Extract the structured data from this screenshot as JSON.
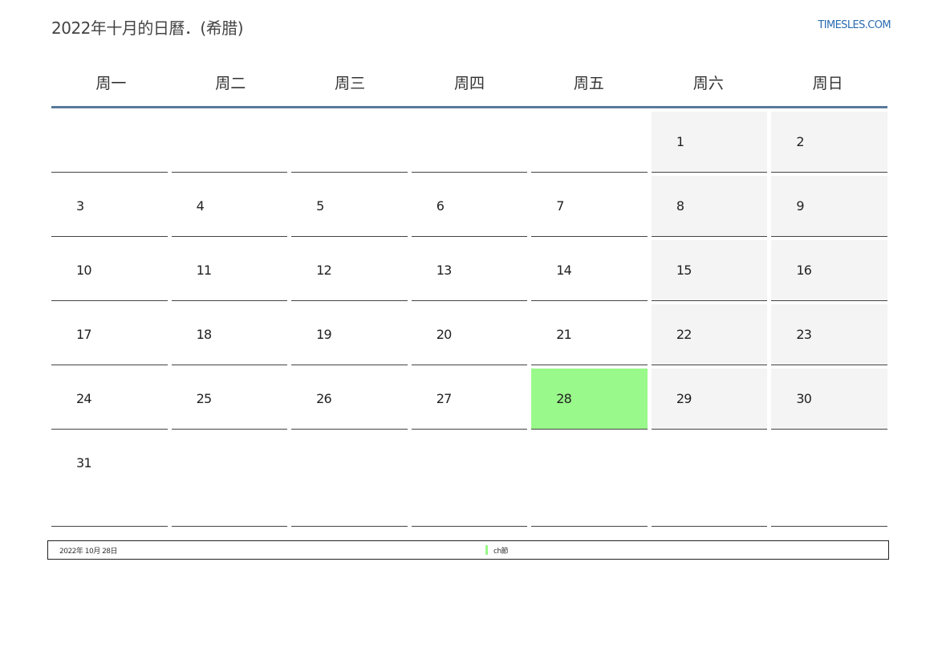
{
  "header": {
    "title": "2022年十月的日曆．(希腊)",
    "site": "TIMESLES.COM"
  },
  "weekdays": [
    "周一",
    "周二",
    "周三",
    "周四",
    "周五",
    "周六",
    "周日"
  ],
  "weeks": [
    [
      "",
      "",
      "",
      "",
      "",
      "1",
      "2"
    ],
    [
      "3",
      "4",
      "5",
      "6",
      "7",
      "8",
      "9"
    ],
    [
      "10",
      "11",
      "12",
      "13",
      "14",
      "15",
      "16"
    ],
    [
      "17",
      "18",
      "19",
      "20",
      "21",
      "22",
      "23"
    ],
    [
      "24",
      "25",
      "26",
      "27",
      "28",
      "29",
      "30"
    ],
    [
      "31",
      "",
      "",
      "",
      "",
      "",
      ""
    ]
  ],
  "today": "28",
  "colors": {
    "today": "#99f98a",
    "weekend": "#f4f4f4",
    "header_rule": "#5a7a9c",
    "link": "#2b6cb0"
  },
  "footer": {
    "date": "2022年 10月 28日",
    "legend_label": "ch節"
  }
}
